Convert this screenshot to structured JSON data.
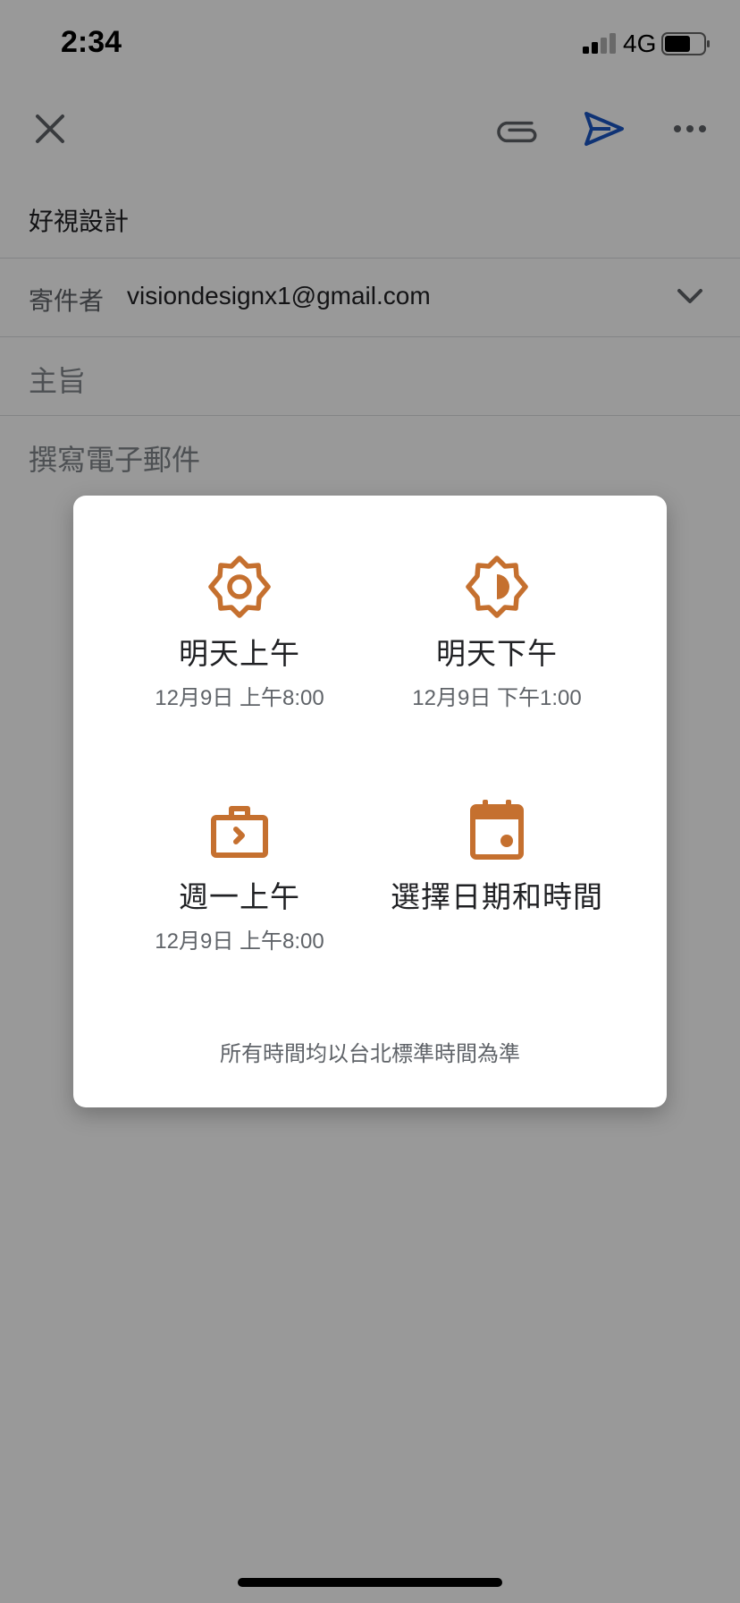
{
  "status_bar": {
    "time": "2:34",
    "network": "4G"
  },
  "compose": {
    "to_value": "好視設計",
    "from_label": "寄件者",
    "from_value": "visiondesignx1@gmail.com",
    "subject_placeholder": "主旨",
    "body_placeholder": "撰寫電子郵件"
  },
  "schedule_dialog": {
    "options": [
      {
        "icon": "sun-icon",
        "title": "明天上午",
        "subtitle": "12月9日 上午8:00"
      },
      {
        "icon": "half-sun-icon",
        "title": "明天下午",
        "subtitle": "12月9日 下午1:00"
      },
      {
        "icon": "briefcase-icon",
        "title": "週一上午",
        "subtitle": "12月9日 上午8:00"
      },
      {
        "icon": "calendar-icon",
        "title": "選擇日期和時間"
      }
    ],
    "timezone_note": "所有時間均以台北標準時間為準"
  },
  "colors": {
    "accent_orange": "#c5702f",
    "send_blue": "#1a56c4"
  }
}
